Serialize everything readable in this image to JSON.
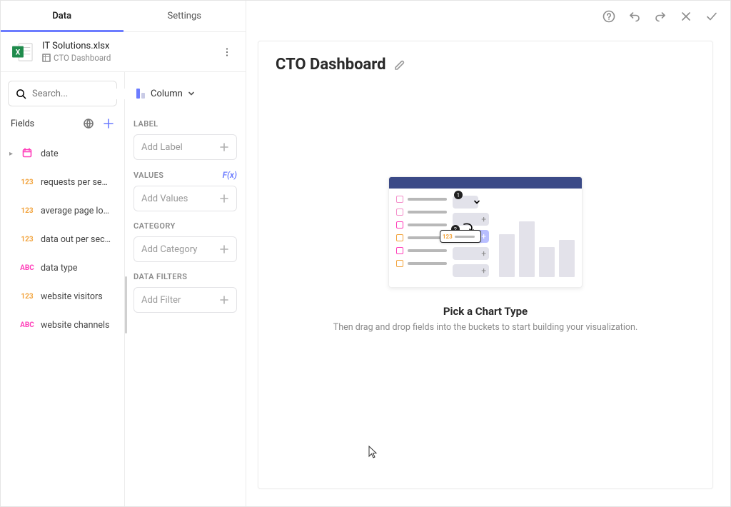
{
  "tabs": {
    "data": "Data",
    "settings": "Settings",
    "active": "data"
  },
  "file": {
    "name": "IT Solutions.xlsx",
    "sheet": "CTO Dashboard"
  },
  "search": {
    "placeholder": "Search..."
  },
  "fieldsHeader": {
    "label": "Fields"
  },
  "chartType": {
    "label": "Column"
  },
  "fields": [
    {
      "name": "date",
      "type": "date",
      "hasChildren": true
    },
    {
      "name": "requests per se…",
      "type": "num"
    },
    {
      "name": "average page lo…",
      "type": "num"
    },
    {
      "name": "data out per sec…",
      "type": "num"
    },
    {
      "name": "data type",
      "type": "abc"
    },
    {
      "name": "website visitors",
      "type": "num"
    },
    {
      "name": "website channels",
      "type": "abc"
    }
  ],
  "buckets": {
    "label": {
      "title": "LABEL",
      "placeholder": "Add Label"
    },
    "values": {
      "title": "VALUES",
      "placeholder": "Add Values",
      "fx": "F(x)"
    },
    "category": {
      "title": "CATEGORY",
      "placeholder": "Add Category"
    },
    "filters": {
      "title": "DATA FILTERS",
      "placeholder": "Add Filter"
    }
  },
  "dashboard": {
    "title": "CTO Dashboard"
  },
  "placeholder": {
    "title": "Pick a Chart Type",
    "subtitle": "Then drag and drop fields into the buckets to start building your visualization."
  }
}
